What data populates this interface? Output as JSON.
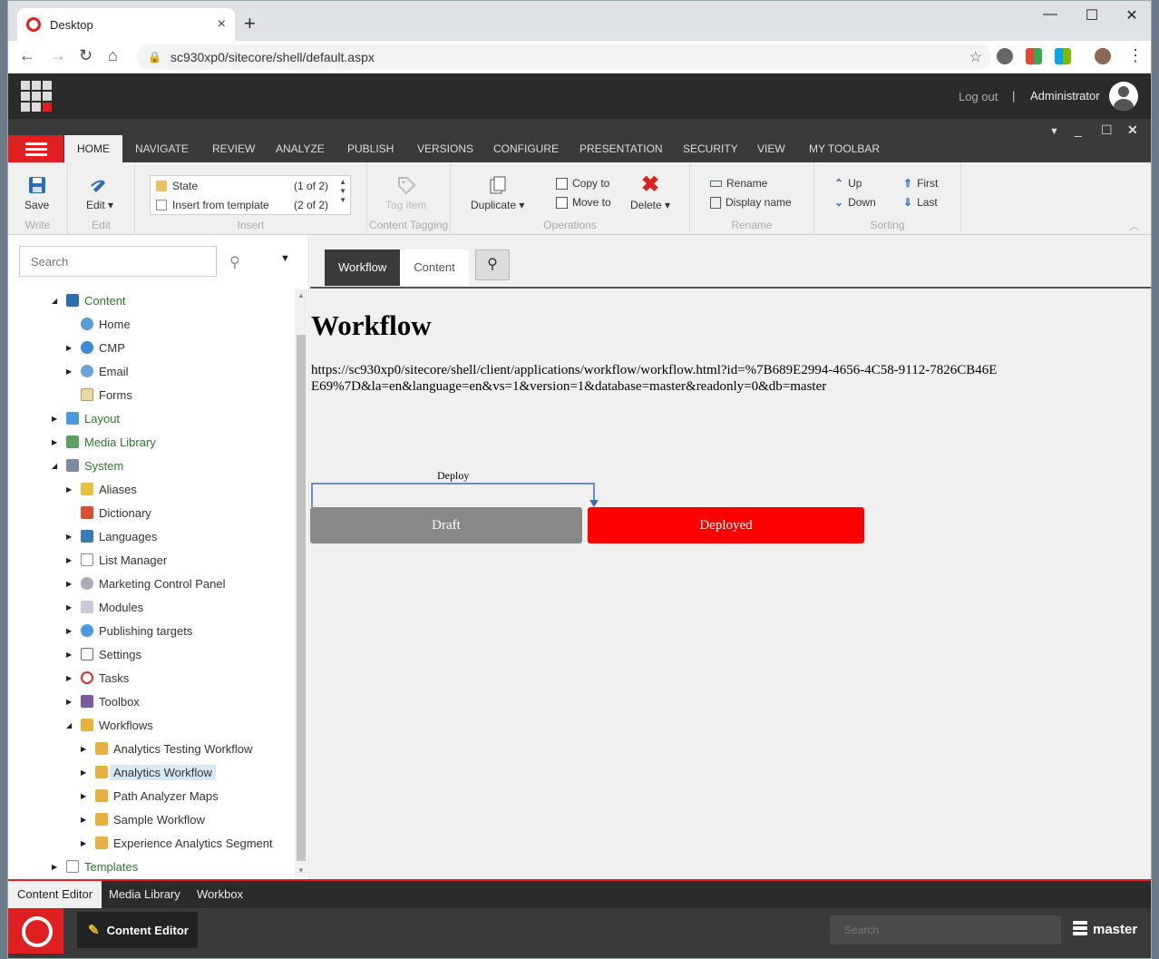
{
  "browser": {
    "tab_title": "Desktop",
    "url": "sc930xp0/sitecore/shell/default.aspx",
    "new_tab": "+",
    "minimize": "—",
    "maximize": "☐",
    "close": "✕"
  },
  "header": {
    "logout": "Log out",
    "separator": "|",
    "user": "Administrator"
  },
  "ribbon_tabs": [
    "HOME",
    "NAVIGATE",
    "REVIEW",
    "ANALYZE",
    "PUBLISH",
    "VERSIONS",
    "CONFIGURE",
    "PRESENTATION",
    "SECURITY",
    "VIEW",
    "MY TOOLBAR"
  ],
  "ribbon": {
    "write": {
      "save": "Save",
      "label": "Write"
    },
    "edit": {
      "edit": "Edit",
      "label": "Edit"
    },
    "insert": {
      "state": "State",
      "state_count": "(1 of 2)",
      "insert_template": "Insert from template",
      "template_count": "(2 of 2)",
      "label": "Insert"
    },
    "tagging": {
      "tag_item": "Tag item",
      "label": "Content Tagging"
    },
    "operations": {
      "duplicate": "Duplicate",
      "copy_to": "Copy to",
      "move_to": "Move to",
      "delete": "Delete",
      "label": "Operations"
    },
    "rename": {
      "rename": "Rename",
      "display_name": "Display name",
      "label": "Rename"
    },
    "sorting": {
      "up": "Up",
      "down": "Down",
      "first": "First",
      "last": "Last",
      "label": "Sorting"
    }
  },
  "left": {
    "search_placeholder": "Search",
    "tree": [
      {
        "label": "Content"
      },
      {
        "label": "Home"
      },
      {
        "label": "CMP"
      },
      {
        "label": "Email"
      },
      {
        "label": "Forms"
      },
      {
        "label": "Layout"
      },
      {
        "label": "Media Library"
      },
      {
        "label": "System"
      },
      {
        "label": "Aliases"
      },
      {
        "label": "Dictionary"
      },
      {
        "label": "Languages"
      },
      {
        "label": "List Manager"
      },
      {
        "label": "Marketing Control Panel"
      },
      {
        "label": "Modules"
      },
      {
        "label": "Publishing targets"
      },
      {
        "label": "Settings"
      },
      {
        "label": "Tasks"
      },
      {
        "label": "Toolbox"
      },
      {
        "label": "Workflows"
      },
      {
        "label": "Analytics Testing Workflow"
      },
      {
        "label": "Analytics Workflow"
      },
      {
        "label": "Path Analyzer Maps"
      },
      {
        "label": "Sample Workflow"
      },
      {
        "label": "Experience Analytics Segment"
      },
      {
        "label": "Templates"
      }
    ]
  },
  "content": {
    "tabs": [
      "Workflow",
      "Content"
    ],
    "heading": "Workflow",
    "url": "https://sc930xp0/sitecore/shell/client/applications/workflow/workflow.html?id=%7B689E2994-4656-4C58-9112-7826CB46EE69%7D&la=en&language=en&vs=1&version=1&database=master&readonly=0&db=master",
    "command": "Deploy",
    "states": [
      "Draft",
      "Deployed"
    ],
    "state_colors": [
      "#888888",
      "#ff0000"
    ]
  },
  "bottom": {
    "tabs": [
      "Content Editor",
      "Media Library",
      "Workbox"
    ],
    "app": "Content Editor",
    "search_placeholder": "Search",
    "database": "master"
  }
}
